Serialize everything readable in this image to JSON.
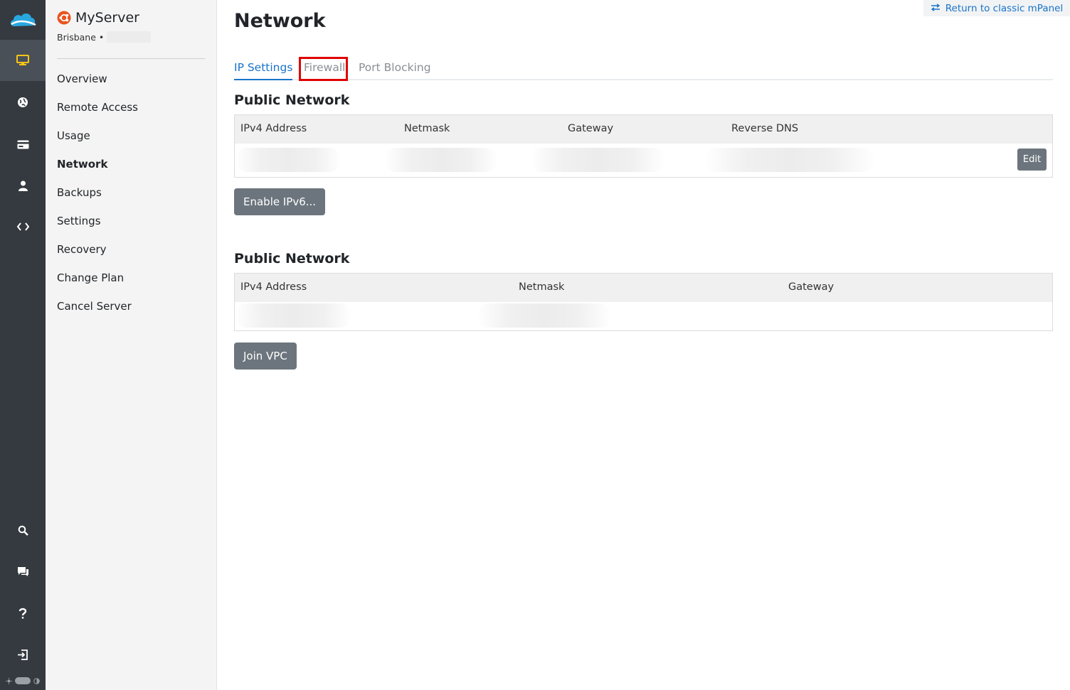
{
  "rail": {
    "items": [
      {
        "icon": "monitor-icon",
        "active": true
      },
      {
        "icon": "globe-icon"
      },
      {
        "icon": "credit-card-icon"
      },
      {
        "icon": "user-icon"
      },
      {
        "icon": "code-icon"
      },
      {
        "icon": "search-icon"
      },
      {
        "icon": "chat-icon"
      },
      {
        "icon": "help-icon"
      },
      {
        "icon": "logout-icon"
      }
    ],
    "colors": {
      "background": "#343a40",
      "active_icon": "#f5c518",
      "icon": "#ffffff"
    }
  },
  "sidebar": {
    "server_name": "MyServer",
    "location": "Brisbane •",
    "os_icon": "ubuntu-icon",
    "nav": [
      "Overview",
      "Remote Access",
      "Usage",
      "Network",
      "Backups",
      "Settings",
      "Recovery",
      "Change Plan",
      "Cancel Server"
    ],
    "active_nav": "Network"
  },
  "header": {
    "title": "Network",
    "return_link": "Return to classic mPanel"
  },
  "tabs": {
    "items": [
      "IP Settings",
      "Firewall",
      "Port Blocking"
    ],
    "active": "IP Settings",
    "highlighted": "Firewall"
  },
  "public_network": {
    "title": "Public Network",
    "columns": [
      "IPv4 Address",
      "Netmask",
      "Gateway",
      "Reverse DNS"
    ],
    "edit_label": "Edit",
    "button": "Enable IPv6..."
  },
  "private_network": {
    "title": "Public Network",
    "columns": [
      "IPv4 Address",
      "Netmask",
      "Gateway"
    ],
    "button": "Join VPC"
  },
  "colors": {
    "accent": "#1a73c8",
    "highlight_box": "#e00000",
    "button": "#6c757d"
  }
}
